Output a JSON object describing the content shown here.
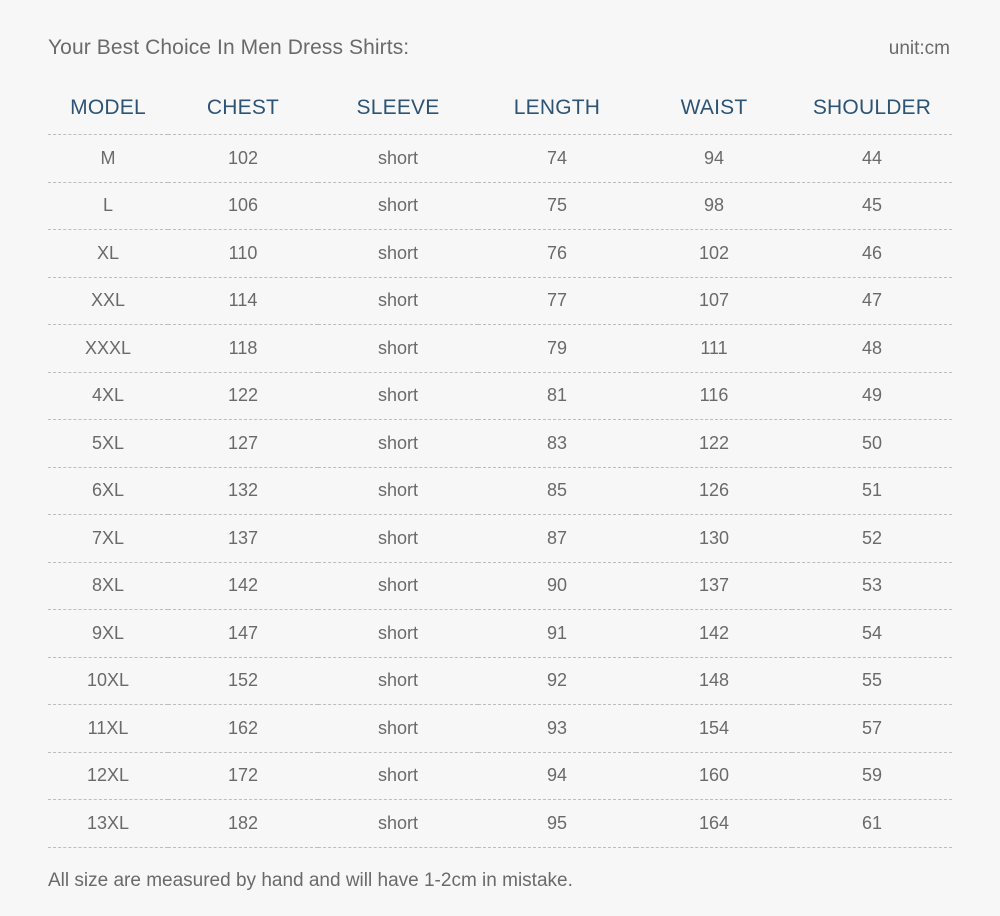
{
  "header": {
    "title": "Your Best Choice In Men Dress Shirts:",
    "unit": "unit:cm"
  },
  "table": {
    "columns": [
      "MODEL",
      "CHEST",
      "SLEEVE",
      "LENGTH",
      "WAIST",
      "SHOULDER"
    ],
    "rows": [
      [
        "M",
        "102",
        "short",
        "74",
        "94",
        "44"
      ],
      [
        "L",
        "106",
        "short",
        "75",
        "98",
        "45"
      ],
      [
        "XL",
        "110",
        "short",
        "76",
        "102",
        "46"
      ],
      [
        "XXL",
        "114",
        "short",
        "77",
        "107",
        "47"
      ],
      [
        "XXXL",
        "118",
        "short",
        "79",
        "111",
        "48"
      ],
      [
        "4XL",
        "122",
        "short",
        "81",
        "116",
        "49"
      ],
      [
        "5XL",
        "127",
        "short",
        "83",
        "122",
        "50"
      ],
      [
        "6XL",
        "132",
        "short",
        "85",
        "126",
        "51"
      ],
      [
        "7XL",
        "137",
        "short",
        "87",
        "130",
        "52"
      ],
      [
        "8XL",
        "142",
        "short",
        "90",
        "137",
        "53"
      ],
      [
        "9XL",
        "147",
        "short",
        "91",
        "142",
        "54"
      ],
      [
        "10XL",
        "152",
        "short",
        "92",
        "148",
        "55"
      ],
      [
        "11XL",
        "162",
        "short",
        "93",
        "154",
        "57"
      ],
      [
        "12XL",
        "172",
        "short",
        "94",
        "160",
        "59"
      ],
      [
        "13XL",
        "182",
        "short",
        "95",
        "164",
        "61"
      ]
    ]
  },
  "footer": {
    "note": "All size are measured by hand and will have 1-2cm in mistake."
  },
  "colors": {
    "background": "#f7f7f7",
    "header_text": "#2d5475",
    "body_text": "#6a6a6a",
    "divider": "#bdbdbd"
  }
}
